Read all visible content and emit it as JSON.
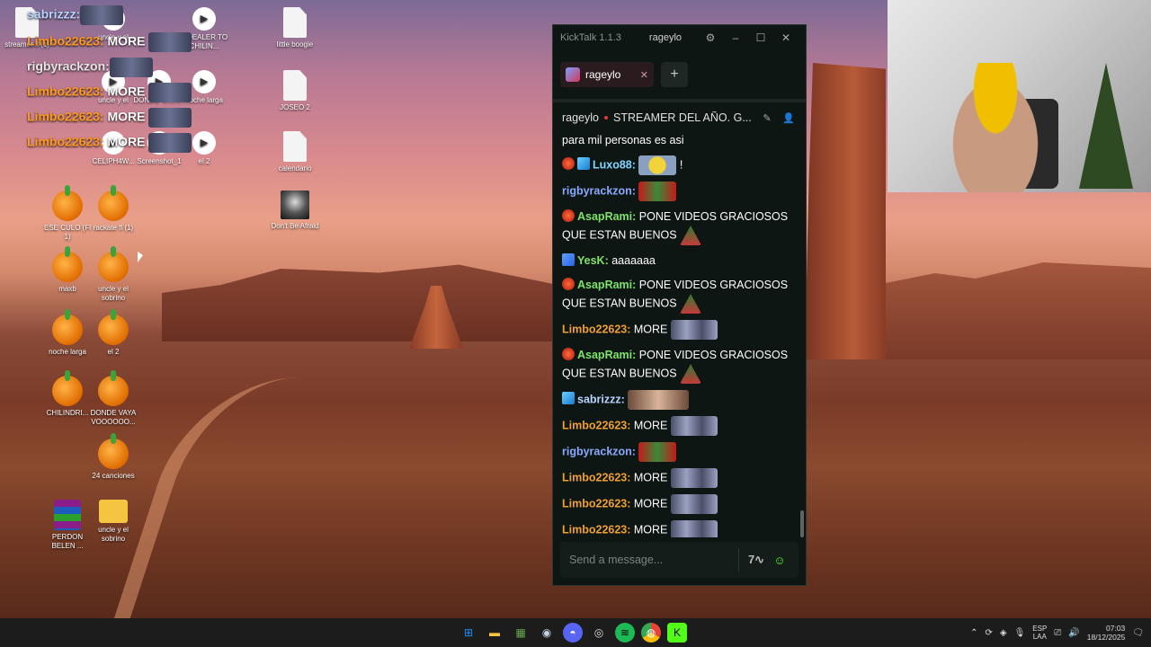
{
  "desktop": {
    "icons": [
      {
        "label": "streamer fl (1)",
        "type": "doc"
      },
      {
        "label": "uncle y el",
        "type": "vid"
      },
      {
        "label": "A DEALER TO CHILIN...",
        "type": "vid"
      },
      {
        "label": "little boogie",
        "type": "doc"
      },
      {
        "label": "uncle y el",
        "type": "vid"
      },
      {
        "label": "DONDE VAYA...",
        "type": "vid"
      },
      {
        "label": "noche larga",
        "type": "vid"
      },
      {
        "label": "JOSEO 2",
        "type": "doc"
      },
      {
        "label": "CELIPH4W...",
        "type": "vid"
      },
      {
        "label": "Screenshot_1",
        "type": "vid"
      },
      {
        "label": "el 2",
        "type": "vid"
      },
      {
        "label": "calendario",
        "type": "doc"
      },
      {
        "label": "Don't Be Afraid",
        "type": "photo"
      },
      {
        "label": "ESE CULO (Fl 1)",
        "type": "fl"
      },
      {
        "label": "rackate fl (1)",
        "type": "fl"
      },
      {
        "label": "maxb",
        "type": "fl"
      },
      {
        "label": "uncle y el sobrino",
        "type": "fl"
      },
      {
        "label": "noche larga",
        "type": "fl"
      },
      {
        "label": "el 2",
        "type": "fl"
      },
      {
        "label": "CHILINDRI...",
        "type": "fl"
      },
      {
        "label": "DONDE VAYA VOOOOOO...",
        "type": "fl"
      },
      {
        "label": "24 canciones",
        "type": "fl"
      },
      {
        "label": "PERDON BELEN ...",
        "type": "rar"
      },
      {
        "label": "uncle y el sobrino",
        "type": "folder"
      }
    ]
  },
  "overlay": {
    "lines": [
      {
        "user": "sabrizzz:",
        "text": "",
        "style": "blue"
      },
      {
        "user": "Limbo22623:",
        "text": "MORE",
        "style": "orange"
      },
      {
        "user": "rigbyrackzon:",
        "text": "",
        "style": "white"
      },
      {
        "user": "Limbo22623:",
        "text": "MORE",
        "style": "orange"
      },
      {
        "user": "Limbo22623:",
        "text": "MORE",
        "style": "orange"
      },
      {
        "user": "Limbo22623:",
        "text": "MORE",
        "style": "orange"
      }
    ]
  },
  "kicktalk": {
    "app_title": "KickTalk 1.1.3",
    "title_user": "rageylo",
    "settings_icon": "gear-icon",
    "tab_label": "rageylo",
    "add_tab": "+",
    "streamer": "rageylo",
    "stream_title": "STREAMER DEL AÑO. G...",
    "top_text": "para mil personas es asi",
    "messages": [
      {
        "user": "Luxo88:",
        "color": "#7fd6ff",
        "badges": [
          "red",
          "blue"
        ],
        "text": "",
        "emote": "minion",
        "tail": "!"
      },
      {
        "user": "rigbyrackzon:",
        "color": "#8aa8ff",
        "badges": [],
        "text": "",
        "emote": "santa",
        "tail": ""
      },
      {
        "user": "AsapRami:",
        "color": "#7ee36a",
        "badges": [
          "red"
        ],
        "text": "PONE VIDEOS GRACIOSOS QUE ESTAN BUENOS",
        "emote": "tree",
        "tail": ""
      },
      {
        "user": "YesK:",
        "color": "#7ee36a",
        "badges": [
          "tri"
        ],
        "text": "aaaaaaa",
        "emote": "",
        "tail": ""
      },
      {
        "user": "AsapRami:",
        "color": "#7ee36a",
        "badges": [
          "red"
        ],
        "text": "PONE VIDEOS GRACIOSOS QUE ESTAN BUENOS",
        "emote": "tree",
        "tail": ""
      },
      {
        "user": "Limbo22623:",
        "color": "#f0a030",
        "badges": [],
        "text": "MORE",
        "emote": "ghosts",
        "tail": ""
      },
      {
        "user": "AsapRami:",
        "color": "#7ee36a",
        "badges": [
          "red"
        ],
        "text": "PONE VIDEOS GRACIOSOS QUE ESTAN BUENOS",
        "emote": "tree",
        "tail": ""
      },
      {
        "user": "sabrizzz:",
        "color": "#b7d4ff",
        "badges": [
          "blue"
        ],
        "text": "",
        "emote": "face",
        "tail": ""
      },
      {
        "user": "Limbo22623:",
        "color": "#f0a030",
        "badges": [],
        "text": "MORE",
        "emote": "ghosts",
        "tail": ""
      },
      {
        "user": "rigbyrackzon:",
        "color": "#8aa8ff",
        "badges": [],
        "text": "",
        "emote": "santa",
        "tail": ""
      },
      {
        "user": "Limbo22623:",
        "color": "#f0a030",
        "badges": [],
        "text": "MORE",
        "emote": "ghosts",
        "tail": ""
      },
      {
        "user": "Limbo22623:",
        "color": "#f0a030",
        "badges": [],
        "text": "MORE",
        "emote": "ghosts",
        "tail": ""
      },
      {
        "user": "Limbo22623:",
        "color": "#f0a030",
        "badges": [],
        "text": "MORE",
        "emote": "ghosts",
        "tail": ""
      }
    ],
    "input_placeholder": "Send a message..."
  },
  "taskbar": {
    "apps": [
      "start-icon",
      "file-explorer-icon",
      "minecraft-icon",
      "steam-icon",
      "discord-icon",
      "obs-icon",
      "spotify-icon",
      "chrome-icon",
      "kick-icon"
    ],
    "lang_line1": "ESP",
    "lang_line2": "LAA",
    "time": "07:03",
    "date": "18/12/2025"
  },
  "colors": {
    "kick_green": "#53fc18",
    "chat_bg": "#0e1613"
  }
}
